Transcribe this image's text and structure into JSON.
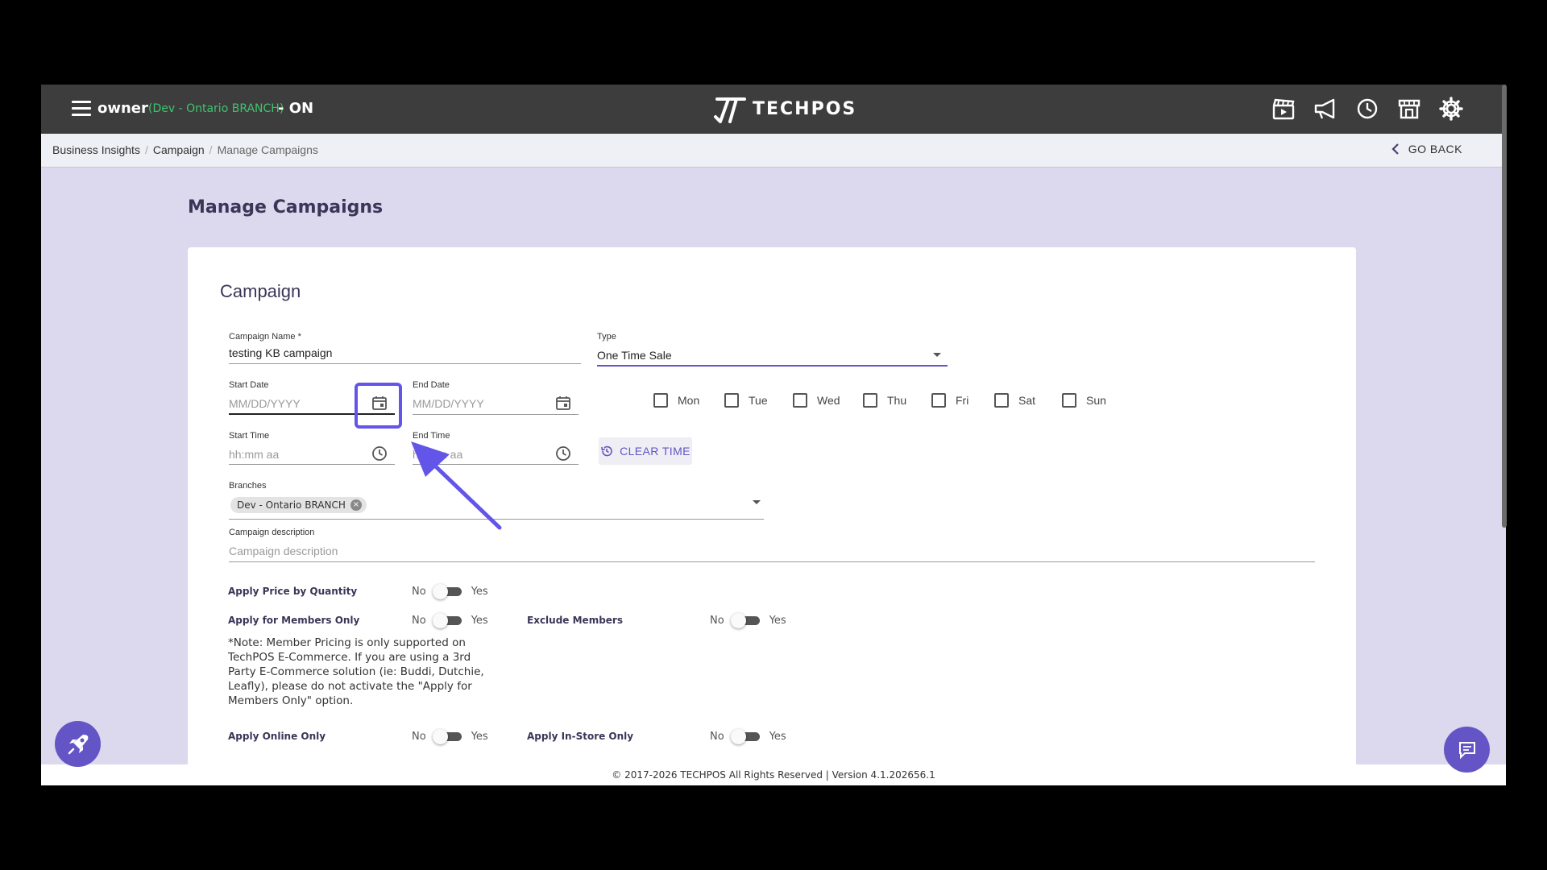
{
  "topbar": {
    "user": "owner",
    "branch": "(Dev - Ontario BRANCH)",
    "status": "- ON",
    "logo_text": "TECHPOS",
    "icons": [
      "clapperboard-icon",
      "megaphone-icon",
      "clock-icon",
      "store-icon",
      "gear-icon"
    ]
  },
  "breadcrumb": {
    "items": [
      "Business Insights",
      "Campaign",
      "Manage Campaigns"
    ],
    "go_back": "GO BACK"
  },
  "page": {
    "title": "Manage Campaigns",
    "card_title": "Campaign"
  },
  "form": {
    "campaign_name_label": "Campaign Name *",
    "campaign_name_value": "testing KB campaign",
    "type_label": "Type",
    "type_value": "One Time Sale",
    "start_date_label": "Start Date",
    "start_date_placeholder": "MM/DD/YYYY",
    "end_date_label": "End Date",
    "end_date_placeholder": "MM/DD/YYYY",
    "start_time_label": "Start Time",
    "start_time_placeholder": "hh:mm aa",
    "end_time_label": "End Time",
    "end_time_placeholder": "hh:mm aa",
    "days": [
      "Mon",
      "Tue",
      "Wed",
      "Thu",
      "Fri",
      "Sat",
      "Sun"
    ],
    "clear_time": "CLEAR TIME",
    "branches_label": "Branches",
    "branch_chip": "Dev - Ontario BRANCH",
    "description_label": "Campaign description",
    "description_placeholder": "Campaign description"
  },
  "toggles": {
    "no": "No",
    "yes": "Yes",
    "price_by_quantity": "Apply Price by Quantity",
    "members_only": "Apply for Members Only",
    "exclude_members": "Exclude Members",
    "online_only": "Apply Online Only",
    "instore_only": "Apply In-Store Only"
  },
  "note": "*Note: Member Pricing is only supported on TechPOS E-Commerce. If you are using a 3rd Party E-Commerce solution (ie: Buddi, Dutchie, Leafly), please do not activate the \"Apply for Members Only\" option.",
  "footer": "© 2017-2026 TECHPOS All Rights Reserved | Version 4.1.202656.1",
  "colors": {
    "accent": "#6355c5",
    "topbar": "#3d3d3d",
    "background": "#dcd8ee",
    "branch_green": "#3ec46d"
  }
}
